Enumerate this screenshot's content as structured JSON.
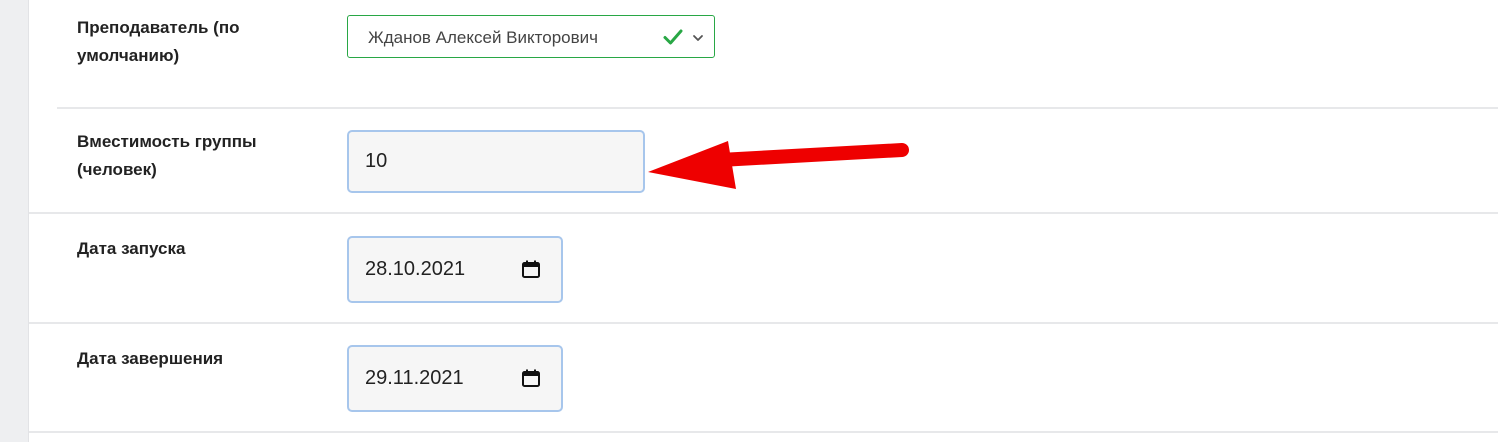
{
  "form": {
    "teacher": {
      "label": "Преподаватель (по\nумолчанию)",
      "value": "Жданов Алексей Викторович",
      "status_icon": "check-icon",
      "status_color": "#28a745"
    },
    "capacity": {
      "label": "Вместимость группы\n(человек)",
      "value": "10"
    },
    "start_date": {
      "label": "Дата запуска",
      "value": "28.10.2021",
      "icon": "calendar-icon"
    },
    "end_date": {
      "label": "Дата завершения",
      "value": "29.11.2021",
      "icon": "calendar-icon"
    }
  },
  "annotation": {
    "arrow_color": "#ee0000",
    "target": "capacity"
  },
  "colors": {
    "valid_border": "#28a745",
    "input_border": "#a7c6ec",
    "input_background": "#f6f6f6"
  }
}
